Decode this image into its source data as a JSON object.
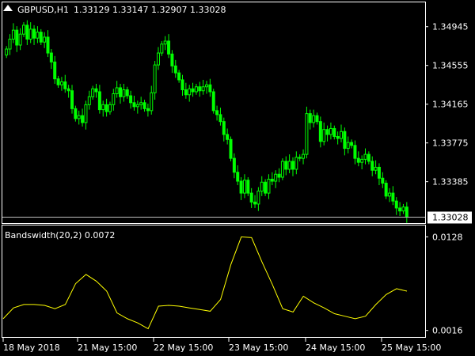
{
  "main_chart": {
    "symbol_label": "GBPUSD,H1",
    "ohlc_label": "1.33129 1.33147 1.32907 1.33028",
    "price_levels": [
      "1.34945",
      "1.34555",
      "1.34165",
      "1.33775",
      "1.33385"
    ],
    "current_price": "1.33028",
    "colors": {
      "background": "#000000",
      "candle": "#00ff00",
      "price_line": "#c0c0c0",
      "text": "#ffffff"
    }
  },
  "indicator": {
    "label": "Bandswidth(20,2) 0.0072",
    "levels": [
      "0.0128",
      "0.0016"
    ],
    "color": "#ffff00"
  },
  "x_labels": [
    "18 May 2018",
    "21 May 15:00",
    "22 May 15:00",
    "23 May 15:00",
    "24 May 15:00",
    "25 May 15:00"
  ],
  "chart_data": [
    {
      "type": "candlestick",
      "title": "GBPUSD,H1",
      "ylim": [
        1.33,
        1.3515
      ],
      "yticks": [
        1.34945,
        1.34555,
        1.34165,
        1.33775,
        1.33385
      ],
      "current_price": 1.33028,
      "close_values": [
        1.3472,
        1.3482,
        1.3491,
        1.3476,
        1.3487,
        1.3496,
        1.3482,
        1.3492,
        1.3483,
        1.3489,
        1.3479,
        1.3484,
        1.3468,
        1.3459,
        1.3442,
        1.3436,
        1.3439,
        1.3432,
        1.343,
        1.3412,
        1.3402,
        1.3405,
        1.3398,
        1.3416,
        1.3424,
        1.3432,
        1.3429,
        1.3411,
        1.3416,
        1.3409,
        1.3416,
        1.3427,
        1.3433,
        1.3424,
        1.3431,
        1.3425,
        1.3418,
        1.3414,
        1.3416,
        1.3418,
        1.3412,
        1.341,
        1.3428,
        1.3456,
        1.3468,
        1.3477,
        1.348,
        1.3467,
        1.3455,
        1.3448,
        1.3441,
        1.3431,
        1.3426,
        1.3432,
        1.3429,
        1.3434,
        1.343,
        1.3434,
        1.3436,
        1.3429,
        1.341,
        1.3406,
        1.3399,
        1.3386,
        1.3381,
        1.3362,
        1.3348,
        1.3339,
        1.3327,
        1.334,
        1.3327,
        1.3318,
        1.3316,
        1.3329,
        1.3338,
        1.3327,
        1.3341,
        1.3339,
        1.3346,
        1.3343,
        1.3359,
        1.3351,
        1.3359,
        1.3351,
        1.3363,
        1.3362,
        1.3366,
        1.3407,
        1.3398,
        1.3405,
        1.3399,
        1.3379,
        1.3391,
        1.3386,
        1.3392,
        1.3384,
        1.3382,
        1.3389,
        1.3372,
        1.3378,
        1.3375,
        1.3362,
        1.3358,
        1.3361,
        1.3366,
        1.3359,
        1.335,
        1.3353,
        1.3342,
        1.3337,
        1.3324,
        1.3327,
        1.3319,
        1.3312,
        1.3309,
        1.3313,
        1.3303
      ]
    },
    {
      "type": "line",
      "title": "Bandswidth(20,2) 0.0072",
      "ylim": [
        0.001,
        0.0135
      ],
      "yticks": [
        0.0128,
        0.0016
      ],
      "x_labels": [
        "18 May 2018",
        "21 May 15:00",
        "22 May 15:00",
        "23 May 15:00",
        "24 May 15:00",
        "25 May 15:00"
      ],
      "values": [
        0.003,
        0.0043,
        0.0047,
        0.0047,
        0.0046,
        0.0042,
        0.0047,
        0.0072,
        0.0083,
        0.0075,
        0.0063,
        0.0037,
        0.003,
        0.0025,
        0.0018,
        0.0045,
        0.0046,
        0.0045,
        0.0043,
        0.0041,
        0.0039,
        0.0053,
        0.0095,
        0.0128,
        0.0127,
        0.0098,
        0.0071,
        0.0042,
        0.0038,
        0.0057,
        0.0049,
        0.0043,
        0.0036,
        0.0033,
        0.003,
        0.0033,
        0.0047,
        0.0059,
        0.0066,
        0.0063
      ]
    }
  ]
}
